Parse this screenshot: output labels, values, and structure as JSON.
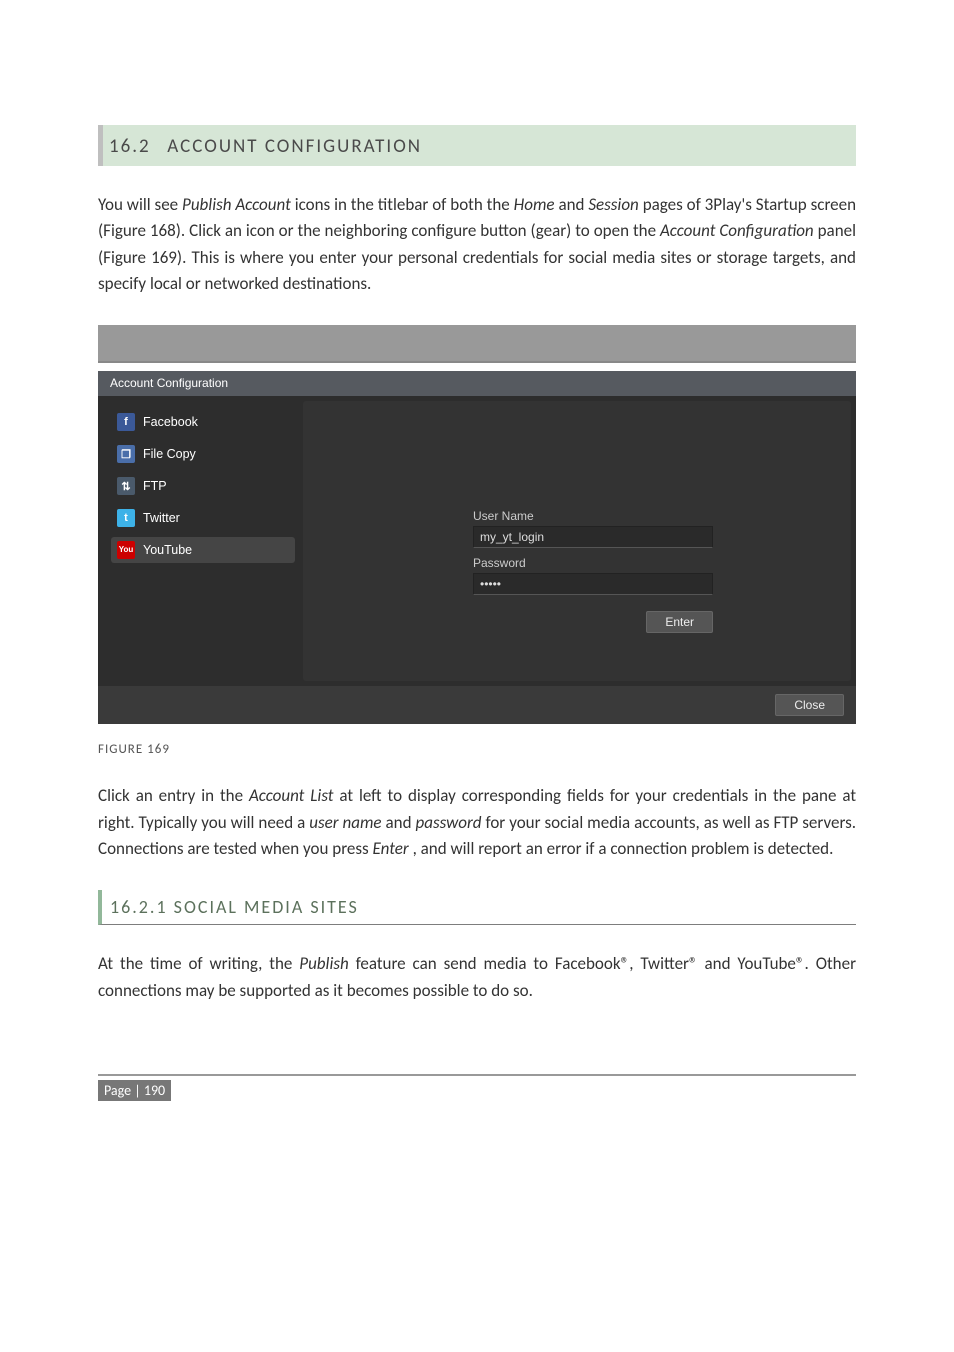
{
  "section": {
    "number": "16.2",
    "title": "ACCOUNT CONFIGURATION"
  },
  "para1_parts": {
    "a": "You will see ",
    "b": "Publish Account",
    "c": " icons in the titlebar of both the ",
    "d": "Home",
    "e": " and ",
    "f": "Session",
    "g": " pages of 3Play's Startup screen (Figure 168). Click an icon or the neighboring configure button (gear) to open the ",
    "h": "Account Configuration",
    "i": " panel (Figure 169).  This is where you enter your personal credentials for social media sites or storage targets, and specify local or networked destinations."
  },
  "dialog": {
    "title": "Account Configuration",
    "accounts": [
      {
        "label": "Facebook",
        "icon_name": "facebook-icon",
        "glyph": "f",
        "cls": "i-fb",
        "selected": false
      },
      {
        "label": "File Copy",
        "icon_name": "file-copy-icon",
        "glyph": "❐",
        "cls": "i-fc",
        "selected": false
      },
      {
        "label": "FTP",
        "icon_name": "ftp-icon",
        "glyph": "⇅",
        "cls": "i-ftp",
        "selected": false
      },
      {
        "label": "Twitter",
        "icon_name": "twitter-icon",
        "glyph": "t",
        "cls": "i-tw",
        "selected": false
      },
      {
        "label": "YouTube",
        "icon_name": "youtube-icon",
        "glyph": "You",
        "cls": "i-yt",
        "selected": true
      }
    ],
    "form": {
      "username_label": "User Name",
      "username_value": "my_yt_login",
      "password_label": "Password",
      "password_value": "•••••",
      "enter_label": "Enter"
    },
    "close_label": "Close"
  },
  "figure_caption": "FIGURE 169",
  "para2_parts": {
    "a": "Click an entry in the ",
    "b": "Account List",
    "c": " at left to display corresponding fields for your credentials in the pane at right.  Typically you will need a ",
    "d": "user name",
    "e": " and ",
    "f": "password",
    "g": " for your social media accounts, as well as FTP servers.  Connections are tested when you press ",
    "h": "Enter",
    "i": ", and will report an error if a connection problem is detected."
  },
  "subsection": {
    "number": "16.2.1",
    "title": "SOCIAL MEDIA SITES"
  },
  "para3_parts": {
    "a": "At the time of writing, the ",
    "b": "Publish",
    "c": " feature can send media to Facebook®, Twitter® and YouTube®.  Other connections may be supported as it becomes possible to do so."
  },
  "footer": {
    "page_label": "Page | 190"
  }
}
